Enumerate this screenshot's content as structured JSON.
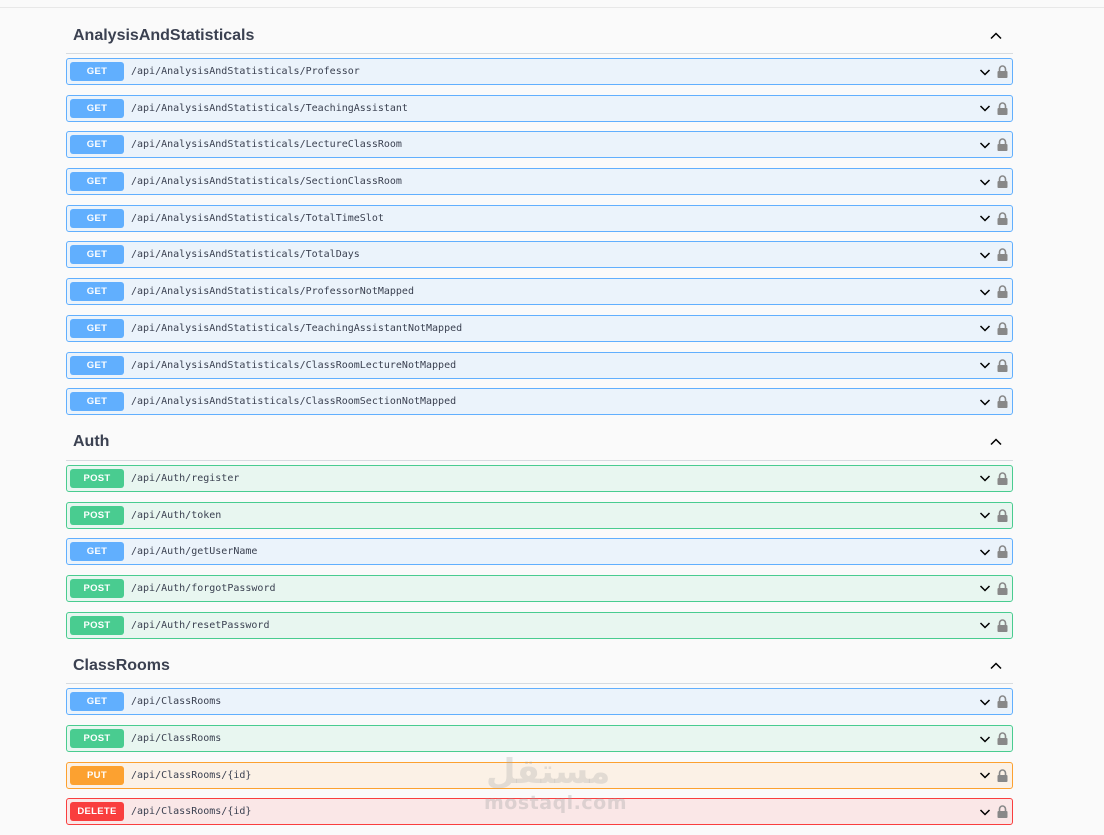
{
  "sections": [
    {
      "title": "AnalysisAndStatisticals",
      "ops": [
        {
          "method": "GET",
          "cls": "get",
          "path": "/api/AnalysisAndStatisticals/Professor"
        },
        {
          "method": "GET",
          "cls": "get",
          "path": "/api/AnalysisAndStatisticals/TeachingAssistant"
        },
        {
          "method": "GET",
          "cls": "get",
          "path": "/api/AnalysisAndStatisticals/LectureClassRoom"
        },
        {
          "method": "GET",
          "cls": "get",
          "path": "/api/AnalysisAndStatisticals/SectionClassRoom"
        },
        {
          "method": "GET",
          "cls": "get",
          "path": "/api/AnalysisAndStatisticals/TotalTimeSlot"
        },
        {
          "method": "GET",
          "cls": "get",
          "path": "/api/AnalysisAndStatisticals/TotalDays"
        },
        {
          "method": "GET",
          "cls": "get",
          "path": "/api/AnalysisAndStatisticals/ProfessorNotMapped"
        },
        {
          "method": "GET",
          "cls": "get",
          "path": "/api/AnalysisAndStatisticals/TeachingAssistantNotMapped"
        },
        {
          "method": "GET",
          "cls": "get",
          "path": "/api/AnalysisAndStatisticals/ClassRoomLectureNotMapped"
        },
        {
          "method": "GET",
          "cls": "get",
          "path": "/api/AnalysisAndStatisticals/ClassRoomSectionNotMapped"
        }
      ]
    },
    {
      "title": "Auth",
      "ops": [
        {
          "method": "POST",
          "cls": "post",
          "path": "/api/Auth/register"
        },
        {
          "method": "POST",
          "cls": "post",
          "path": "/api/Auth/token"
        },
        {
          "method": "GET",
          "cls": "get",
          "path": "/api/Auth/getUserName"
        },
        {
          "method": "POST",
          "cls": "post",
          "path": "/api/Auth/forgotPassword"
        },
        {
          "method": "POST",
          "cls": "post",
          "path": "/api/Auth/resetPassword"
        }
      ]
    },
    {
      "title": "ClassRooms",
      "ops": [
        {
          "method": "GET",
          "cls": "get",
          "path": "/api/ClassRooms"
        },
        {
          "method": "POST",
          "cls": "post",
          "path": "/api/ClassRooms"
        },
        {
          "method": "PUT",
          "cls": "put",
          "path": "/api/ClassRooms/{id}"
        },
        {
          "method": "DELETE",
          "cls": "delete",
          "path": "/api/ClassRooms/{id}"
        }
      ]
    }
  ],
  "watermark": {
    "arabic": "مستقل",
    "latin": "mostaql.com"
  },
  "colors": {
    "get": "#61affe",
    "post": "#49cc90",
    "put": "#fca130",
    "delete": "#f93e3e"
  }
}
